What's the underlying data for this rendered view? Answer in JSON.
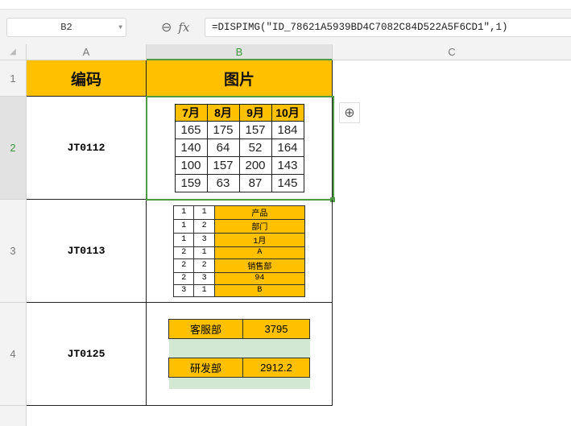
{
  "formula_bar": {
    "name_box": "B2",
    "formula": "=DISPIMG(\"ID_78621A5939BD4C7082C84D522A5F6CD1\",1)"
  },
  "columns": [
    "A",
    "B",
    "C"
  ],
  "rows": [
    "1",
    "2",
    "3",
    "4"
  ],
  "headers": {
    "a1": "编码",
    "b1": "图片"
  },
  "codes": [
    "JT0112",
    "JT0113",
    "JT0125"
  ],
  "image1": {
    "headers": [
      "7月",
      "8月",
      "9月",
      "10月"
    ],
    "rows": [
      [
        "165",
        "175",
        "157",
        "184"
      ],
      [
        "140",
        "64",
        "52",
        "164"
      ],
      [
        "100",
        "157",
        "200",
        "143"
      ],
      [
        "159",
        "63",
        "87",
        "145"
      ]
    ]
  },
  "image2": {
    "rows": [
      [
        "1",
        "1",
        "产品"
      ],
      [
        "1",
        "2",
        "部门"
      ],
      [
        "1",
        "3",
        "1月"
      ],
      [
        "2",
        "1",
        "A"
      ],
      [
        "2",
        "2",
        "销售部"
      ],
      [
        "2",
        "3",
        "94"
      ],
      [
        "3",
        "1",
        "B"
      ]
    ]
  },
  "image3": {
    "rows": [
      [
        "客服部",
        "3795"
      ],
      [
        "研发部",
        "2912.2"
      ]
    ]
  },
  "colors": {
    "accent": "#ffc000",
    "selection": "#4e9a45"
  }
}
